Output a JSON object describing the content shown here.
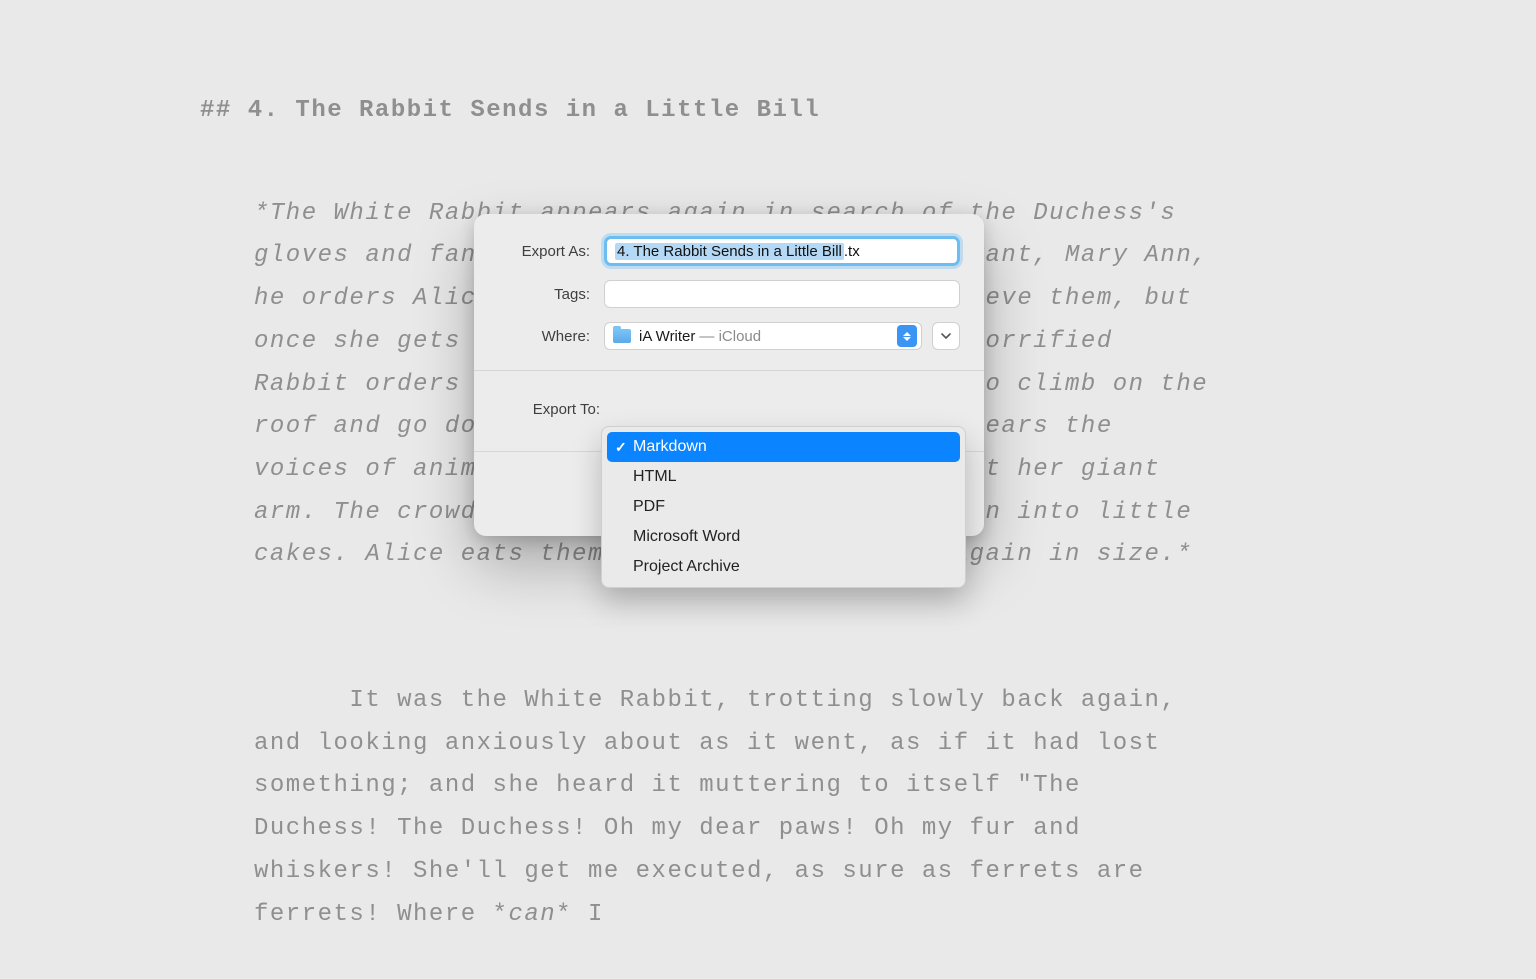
{
  "document": {
    "heading": "## 4. The Rabbit Sends in a Little Bill",
    "italic_block": "*The White Rabbit appears again in search of the Duchess's gloves and fan. Mistaking her for his maidservant, Mary Ann, he orders Alice to go into the house and retrieve them, but once she gets inside she starts growing. The horrified Rabbit orders his gardener, Bill the Lizard, to climb on the roof and go down the chimney. Outside, Alice hears the voices of animals that have gathered to gawk at her giant arm. The crowd hurls pebbles at her, which turn into little cakes. Alice eats them, and they reduce her again in size.*",
    "body_block_pre": "It was the White Rabbit, trotting slowly back again, and looking anxiously about as it went, as if it had lost something; and she heard it muttering to itself \"The Duchess! The Duchess! Oh my dear paws! Oh my fur and whiskers! She'll get me executed, as sure as ferrets are ferrets! Where *",
    "body_block_em": "can",
    "body_block_post": "* I"
  },
  "dialog": {
    "export_as_label": "Export As:",
    "filename_selected": "4. The Rabbit Sends in a Little Bill",
    "filename_ext": ".tx",
    "tags_label": "Tags:",
    "where_label": "Where:",
    "where_main": "iA Writer",
    "where_sub": "— iCloud",
    "export_to_label": "Export To:"
  },
  "dropdown": {
    "items": [
      {
        "label": "Markdown",
        "selected": true
      },
      {
        "label": "HTML",
        "selected": false
      },
      {
        "label": "PDF",
        "selected": false
      },
      {
        "label": "Microsoft Word",
        "selected": false
      },
      {
        "label": "Project Archive",
        "selected": false
      }
    ]
  }
}
